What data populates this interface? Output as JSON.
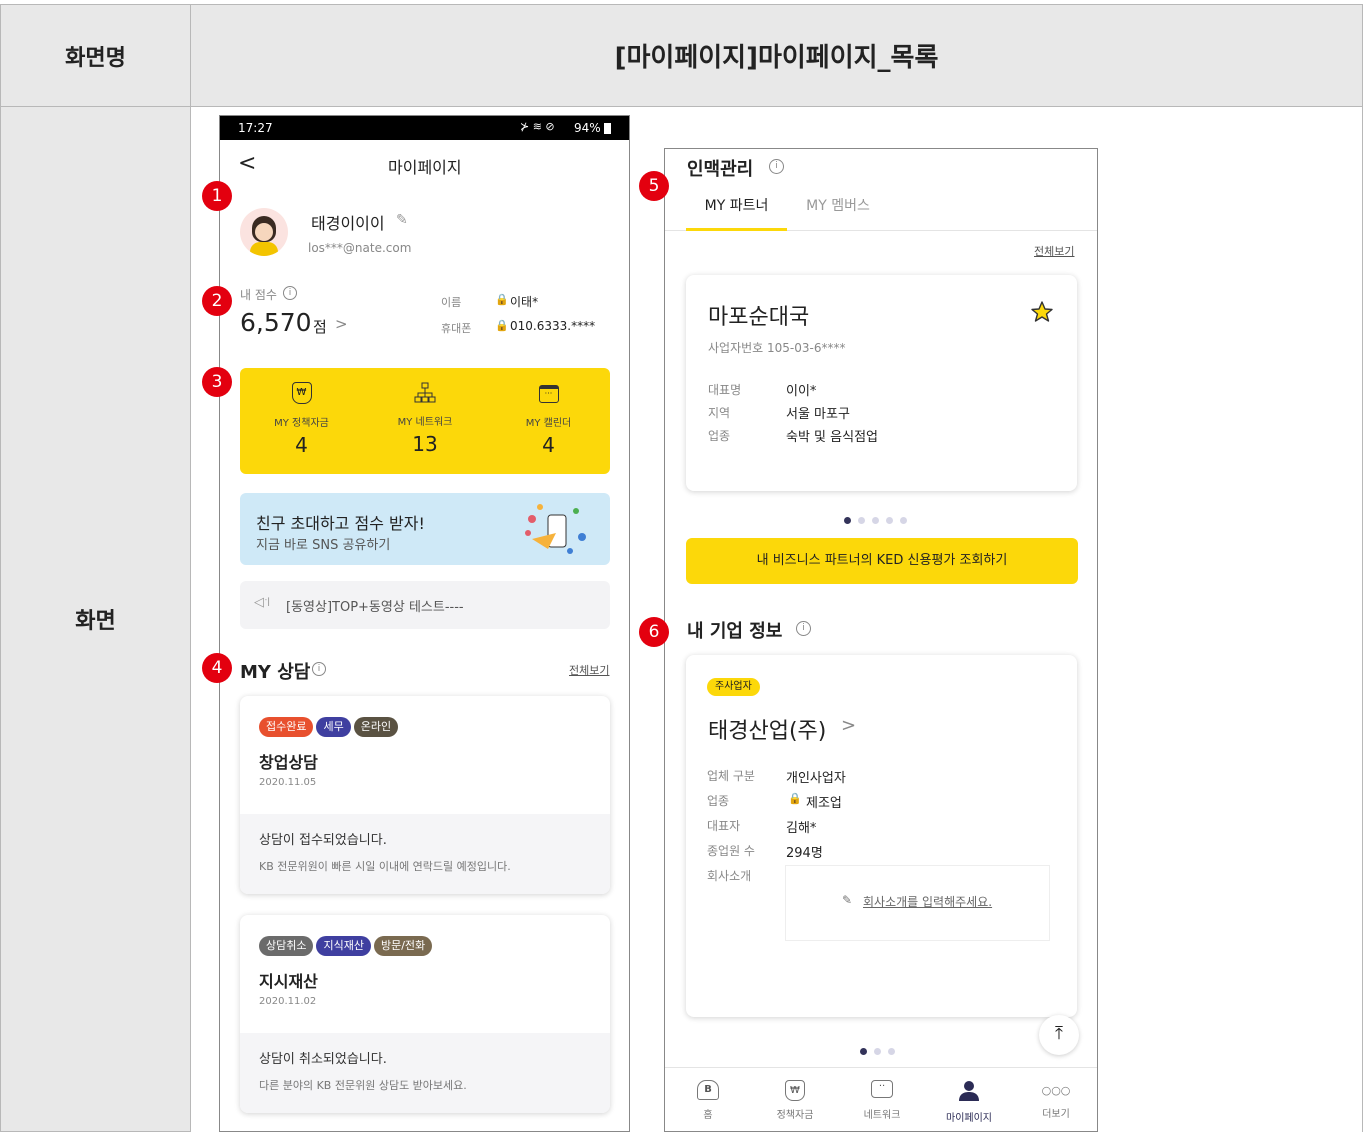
{
  "table": {
    "screen_name_label": "화면명",
    "screen_name_value": "[마이페이지]마이페이지_목록",
    "screen_label": "화면"
  },
  "markers": [
    "1",
    "2",
    "3",
    "4",
    "5",
    "6"
  ],
  "left_screen": {
    "status": {
      "time": "17:27",
      "battery": "94%"
    },
    "header": {
      "back_icon": "chevron-left-icon",
      "title": "마이페이지"
    },
    "profile": {
      "name": "태경이이이",
      "email": "los***@nate.com",
      "edit_icon": "pencil-icon"
    },
    "score": {
      "label": "내 점수",
      "value": "6,570",
      "unit": "점",
      "name_label": "이름",
      "name_value": "이태*",
      "phone_label": "휴대폰",
      "phone_value": "010.6333.****"
    },
    "stats": [
      {
        "icon": "money-bag-icon",
        "label": "MY 정책자금",
        "value": "4"
      },
      {
        "icon": "network-icon",
        "label": "MY 네트워크",
        "value": "13"
      },
      {
        "icon": "calendar-icon",
        "label": "MY 캘린더",
        "value": "4"
      }
    ],
    "invite": {
      "title": "친구 초대하고 점수 받자!",
      "subtitle": "지금 바로 SNS 공유하기"
    },
    "notice": {
      "text": "[동영상]TOP+동영상 테스트----"
    },
    "consult": {
      "title": "MY 상담",
      "view_all": "전체보기",
      "items": [
        {
          "tags": [
            {
              "text": "접수완료",
              "color": "#e8502e"
            },
            {
              "text": "세무",
              "color": "#3f3fa0"
            },
            {
              "text": "온라인",
              "color": "#5a5242"
            }
          ],
          "title": "창업상담",
          "date": "2020.11.05",
          "status": "상담이 접수되었습니다.",
          "desc": "KB 전문위원이 빠른 시일 이내에 연락드릴 예정입니다."
        },
        {
          "tags": [
            {
              "text": "상담취소",
              "color": "#6b6b6b"
            },
            {
              "text": "지식재산",
              "color": "#3f3fa0"
            },
            {
              "text": "방문/전화",
              "color": "#7a6a50"
            }
          ],
          "title": "지시재산",
          "date": "2020.11.02",
          "status": "상담이 취소되었습니다.",
          "desc": "다른 분야의 KB 전문위원 상담도 받아보세요."
        }
      ]
    }
  },
  "right_screen": {
    "network": {
      "title": "인맥관리",
      "tabs": [
        {
          "label": "MY 파트너",
          "active": true
        },
        {
          "label": "MY 멤버스",
          "active": false
        }
      ],
      "view_all": "전체보기",
      "partner": {
        "name": "마포순대국",
        "biz_no": "사업자번호 105-03-6****",
        "rows": [
          {
            "label": "대표명",
            "value": "이이*"
          },
          {
            "label": "지역",
            "value": "서울 마포구"
          },
          {
            "label": "업종",
            "value": "숙박 및 음식점업"
          }
        ]
      },
      "pager": {
        "count": 5,
        "active": 0
      },
      "cta": "내 비즈니스 파트너의 KED 신용평가 조회하기"
    },
    "company": {
      "title": "내 기업 정보",
      "badge": "주사업자",
      "name": "태경산업(주)",
      "rows": [
        {
          "label": "업체 구분",
          "value": "개인사업자",
          "lock": false
        },
        {
          "label": "업종",
          "value": "제조업",
          "lock": true
        },
        {
          "label": "대표자",
          "value": "김해*",
          "lock": false
        },
        {
          "label": "종업원 수",
          "value": "294명",
          "lock": false
        }
      ],
      "intro_label": "회사소개",
      "intro_placeholder": "회사소개를 입력해주세요.",
      "pager": {
        "count": 3,
        "active": 0
      }
    },
    "bottom_nav": [
      {
        "icon": "home-icon",
        "label": "홈"
      },
      {
        "icon": "money-bag-icon",
        "label": "정책자금"
      },
      {
        "icon": "chat-icon",
        "label": "네트워크"
      },
      {
        "icon": "person-icon",
        "label": "마이페이지",
        "active": true
      },
      {
        "icon": "more-icon",
        "label": "더보기"
      }
    ]
  }
}
